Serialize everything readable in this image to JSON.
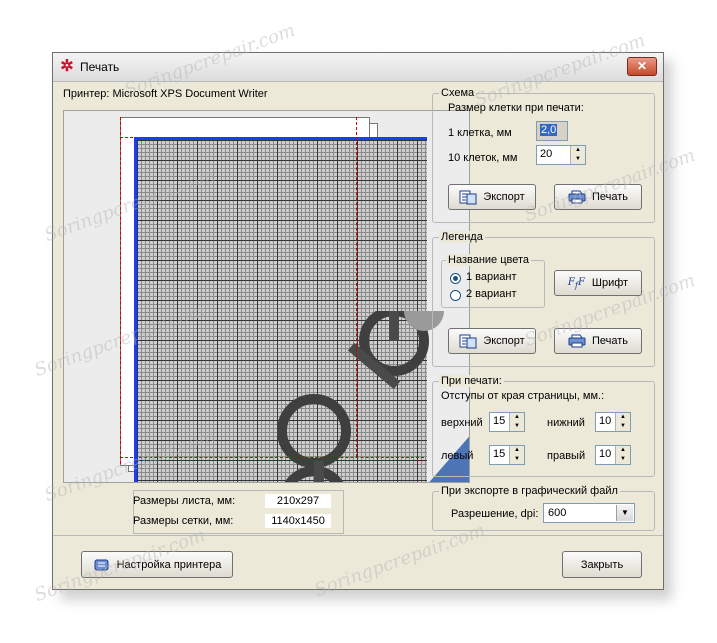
{
  "window": {
    "title": "Печать",
    "close_glyph": "✕"
  },
  "printer": {
    "label": "Принтер:  Microsoft XPS Document Writer"
  },
  "sizes": {
    "sheet_label": "Размеры листа, мм:",
    "sheet_value": "210x297",
    "grid_label": "Размеры сетки, мм:",
    "grid_value": "1140x1450"
  },
  "scheme": {
    "title": "Схема",
    "cell_size_label": "Размер клетки при печати:",
    "one_cell_label": "1 клетка, мм",
    "one_cell_value": "2,0",
    "ten_cells_label": "10 клеток, мм",
    "ten_cells_value": "20",
    "export_label": "Экспорт",
    "print_label": "Печать"
  },
  "legend": {
    "title": "Легенда",
    "color_name_title": "Название цвета",
    "option1": "1 вариант",
    "option2": "2 вариант",
    "font_label": "Шрифт",
    "export_label": "Экспорт",
    "print_label": "Печать"
  },
  "printing": {
    "title": "При печати:",
    "margins_label": "Отступы от края страницы, мм.:",
    "top_label": "верхний",
    "top_value": "15",
    "bottom_label": "нижний",
    "bottom_value": "10",
    "left_label": "левый",
    "left_value": "15",
    "right_label": "правый",
    "right_value": "10"
  },
  "export_image": {
    "title": "При экспорте в графический файл",
    "resolution_label": "Разрешение, dpi:",
    "resolution_value": "600"
  },
  "footer": {
    "printer_setup_label": "Настройка принтера",
    "close_label": "Закрыть"
  },
  "watermark": {
    "text": "Soringpcrepair.com"
  }
}
